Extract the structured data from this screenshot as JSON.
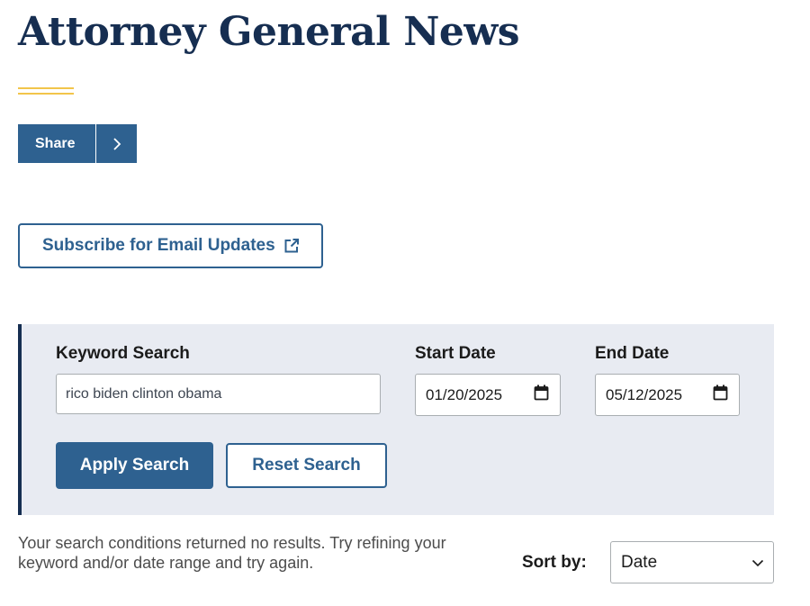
{
  "page": {
    "title": "Attorney General News"
  },
  "share": {
    "label": "Share",
    "icon": "chevron-right-icon"
  },
  "subscribe": {
    "label": "Subscribe for Email Updates",
    "icon": "external-link-icon"
  },
  "search": {
    "keyword_label": "Keyword Search",
    "keyword_value": "rico biden clinton obama",
    "start_label": "Start Date",
    "start_value": "01/20/2025",
    "end_label": "End Date",
    "end_value": "05/12/2025",
    "apply_label": "Apply Search",
    "reset_label": "Reset Search"
  },
  "results": {
    "message": "Your search conditions returned no results. Try refining your keyword and/or date range and try again."
  },
  "sort": {
    "label": "Sort by:",
    "value": "Date"
  },
  "colors": {
    "brand_navy": "#162e51",
    "button_blue": "#2e6190",
    "gold_accent": "#f2c54b",
    "panel_bg": "#e8ebf2"
  }
}
